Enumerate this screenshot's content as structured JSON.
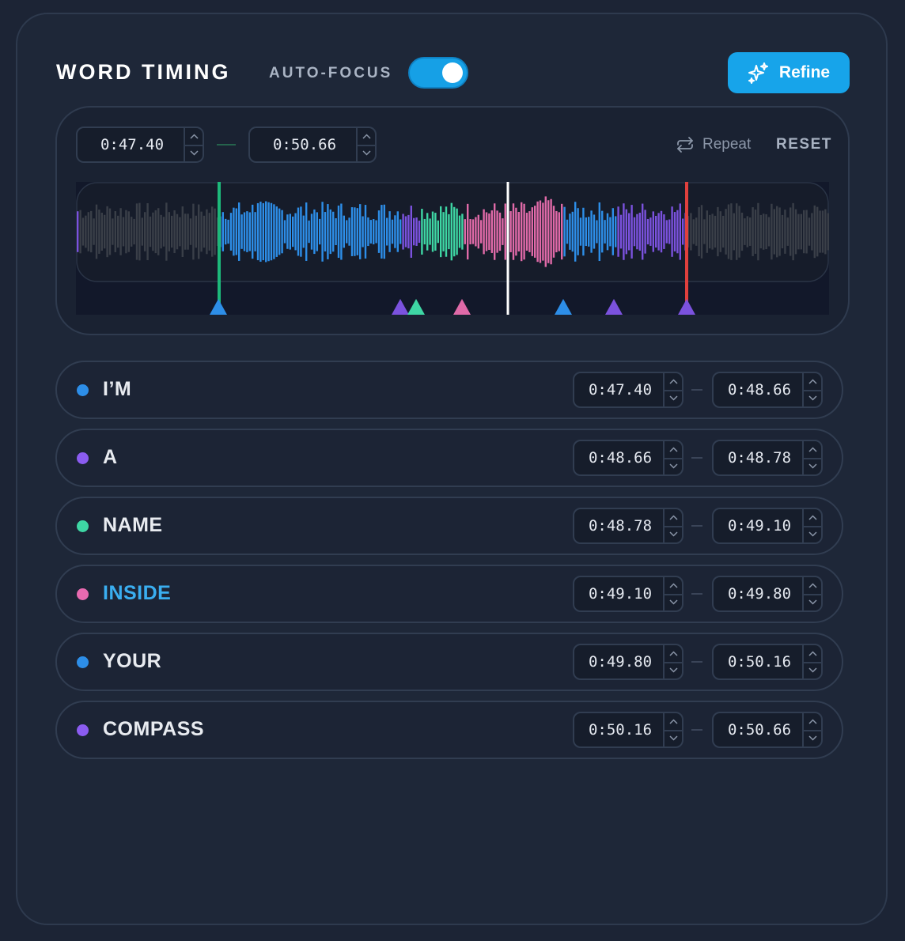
{
  "header": {
    "title": "WORD TIMING",
    "autofocus_label": "AUTO-FOCUS",
    "autofocus_on": true,
    "refine_label": "Refine"
  },
  "range": {
    "start": "0:47.40",
    "end": "0:50.66",
    "repeat_label": "Repeat",
    "reset_label": "RESET"
  },
  "colors": {
    "accent": "#17a4ea",
    "blue": "#2d8ee8",
    "purple": "#7b52de",
    "green": "#3ed6a4",
    "pink": "#e06aa8",
    "gray": "#3a3f48",
    "start_marker": "#1db87a",
    "end_marker": "#e0403d",
    "playhead": "#ffffff",
    "active_word": "#3aaef0"
  },
  "words": [
    {
      "word": "I'M",
      "start": "0:47.40",
      "end": "0:48.66",
      "color": "#2d8ee8",
      "active": false
    },
    {
      "word": "A",
      "start": "0:48.66",
      "end": "0:48.78",
      "color": "#8b5cf0",
      "active": false
    },
    {
      "word": "NAME",
      "start": "0:48.78",
      "end": "0:49.10",
      "color": "#3ed6a4",
      "active": false
    },
    {
      "word": "INSIDE",
      "start": "0:49.10",
      "end": "0:49.80",
      "color": "#e86ab0",
      "active": true
    },
    {
      "word": "YOUR",
      "start": "0:49.80",
      "end": "0:50.16",
      "color": "#2d8ee8",
      "active": false
    },
    {
      "word": "COMPASS",
      "start": "0:50.16",
      "end": "0:50.66",
      "color": "#8b5cf0",
      "active": false
    }
  ]
}
